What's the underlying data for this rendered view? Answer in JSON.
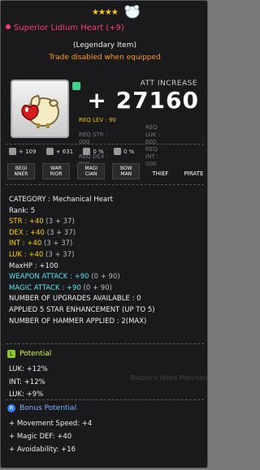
{
  "header": {
    "stars": "★★★★",
    "star_toggle_icon": "white-glove-icon",
    "item_name": "Superior Lidium Heart (+9)",
    "rarity": "(Legendary Item)",
    "trade": "Trade disabled when equipped"
  },
  "item_icon": "lidium-heart-icon",
  "att_increase": {
    "label": "ATT INCREASE",
    "value": "+ 27160"
  },
  "requirements": {
    "rows": [
      [
        "REQ LEV : 90",
        "",
        "",
        ""
      ],
      [
        "REQ STR : 000",
        "",
        "REQ LUK : 000",
        ""
      ],
      [
        "REQ DEX : 000",
        "",
        "REQ INT : 000",
        ""
      ]
    ]
  },
  "icon_stats": [
    {
      "icon": "flame-icon",
      "value": "+ 109"
    },
    {
      "icon": "hammer-icon",
      "value": "+ 631"
    },
    {
      "icon": "star-force-icon",
      "value": "0 %"
    },
    {
      "icon": "shield-icon",
      "value": "0 %"
    }
  ],
  "classes": [
    "BEGI\nNNER",
    "WAR\nRIOR",
    "MAGI\nCIAN",
    "BOW\nMAN",
    "THIEF",
    "PIRATE"
  ],
  "stats": {
    "category": "CATEGORY : Mechanical Heart",
    "rank": "Rank: 5",
    "str": {
      "label": "STR : +40",
      "detail": " (3 + 37)"
    },
    "dex": {
      "label": "DEX : +40",
      "detail": " (3 + 37)"
    },
    "int": {
      "label": "INT : +40",
      "detail": " (3 + 37)"
    },
    "luk": {
      "label": "LUK : +40",
      "detail": " (3 + 37)"
    },
    "maxhp": "MaxHP : +100",
    "weapon_attack": {
      "label": "WEAPON ATTACK : +90",
      "detail": " (0 + 90)"
    },
    "magic_attack": {
      "label": "MAGIC ATTACK : +90",
      "detail": " (0 + 90)"
    },
    "upgrades": "NUMBER OF UPGRADES AVAILABLE : 0",
    "star_enh": "APPLIED 5 STAR ENHANCEMENT (UP TO 5)",
    "hammer": "NUMBER OF HAMMER APPLIED : 2(MAX)"
  },
  "potential": {
    "badge": "L",
    "title": "Potential",
    "lines": [
      "LUK: +12%",
      "INT: +12%",
      "LUK: +9%"
    ]
  },
  "bonus_potential": {
    "badge": "R",
    "title": "Bonus Potential",
    "lines": [
      "+ Movement Speed: +4",
      "+ Magic DEF: +40",
      "+ Avoidability: +16"
    ]
  },
  "background": {
    "text": "Blazoir's Hired Merchan"
  }
}
